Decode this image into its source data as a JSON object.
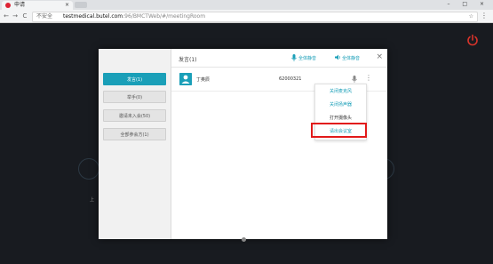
{
  "browser": {
    "tab_title": "申请",
    "tab_close": "×",
    "window_controls": "– □ ×",
    "secure_label": "不安全",
    "url_host": "testmedical.butel.com",
    "url_path": ":96/BMCTWeb/#/meetingRoom",
    "back_icon": "←",
    "forward_icon": "→",
    "reload_icon": "C",
    "star_icon": "☆",
    "menu_icon": "⋮"
  },
  "background": {
    "text": "上"
  },
  "dialog": {
    "title": "发言(1)",
    "mute_all_label": "全体静音",
    "unmute_all_label": "全体静音",
    "close_icon": "×",
    "sidebar": [
      {
        "label": "发言(1)",
        "active": true
      },
      {
        "label": "举手(0)",
        "active": false
      },
      {
        "label": "邀请未入会(50)",
        "active": false
      },
      {
        "label": "全部参会方(1)",
        "active": false
      }
    ],
    "member": {
      "name": "丁奥辰",
      "id": "62000321",
      "more_icon": "⋮"
    },
    "context_menu": [
      {
        "label": "关闭麦克风"
      },
      {
        "label": "关闭扬声器"
      },
      {
        "label": "打开摄像头"
      },
      {
        "label": "请出会议室"
      }
    ]
  },
  "colors": {
    "accent": "#1a9fb8",
    "highlight": "#e21a1a",
    "power": "#d9342b"
  }
}
